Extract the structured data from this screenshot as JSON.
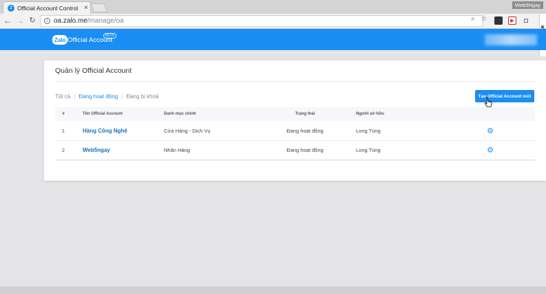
{
  "browser": {
    "tab_title": "Official Account Control",
    "tab_close": "×",
    "window_user": "Web5Ngay",
    "url_host": "oa.zalo.me",
    "url_path": "/manage/oa",
    "side_letter": "K"
  },
  "header": {
    "logo": "Zalo",
    "brand": "Official Account",
    "badge": "BETA"
  },
  "page": {
    "title": "Quản lý Official Account",
    "filters": [
      "Tất cả",
      "Đang hoạt động",
      "Đang bị khoá"
    ],
    "create_button": "Tạo Official Account mới"
  },
  "table": {
    "headers": [
      "#",
      "Tên Official Account",
      "Danh mục chính",
      "Trạng thái",
      "Người sở hữu",
      ""
    ],
    "rows": [
      {
        "index": "1",
        "name": "Hàng Công Nghệ",
        "category": "Cửa Hàng - Dịch Vụ",
        "status": "Đang hoạt động",
        "owner": "Long Tùng"
      },
      {
        "index": "2",
        "name": "Web5ngay",
        "category": "Nhãn Hàng",
        "status": "Đang hoạt động",
        "owner": "Long Tùng"
      }
    ]
  },
  "colors": {
    "brand_blue": "#1a8ef2",
    "link_blue": "#1a6fc0"
  },
  "icons": [
    "zalo-favicon",
    "close-icon",
    "back-arrow-icon",
    "forward-arrow-icon",
    "reload-icon",
    "info-icon",
    "zoom-icon",
    "star-icon",
    "gear-icon",
    "cursor-icon"
  ]
}
